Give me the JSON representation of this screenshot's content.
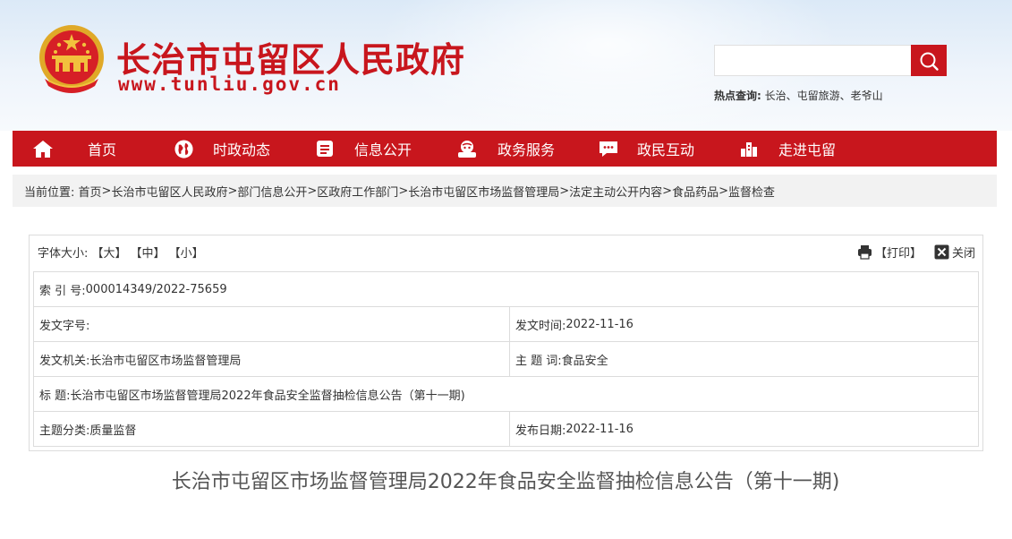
{
  "header": {
    "site_title": "长治市屯留区人民政府",
    "site_url": "www.tunliu.gov.cn",
    "hot_label": "热点查询:",
    "hot_items": "长治、屯留旅游、老爷山",
    "search_placeholder": ""
  },
  "nav": {
    "items": [
      {
        "label": "首页",
        "icon": "home-icon"
      },
      {
        "label": "时政动态",
        "icon": "globe-icon"
      },
      {
        "label": "信息公开",
        "icon": "document-icon"
      },
      {
        "label": "政务服务",
        "icon": "service-icon"
      },
      {
        "label": "政民互动",
        "icon": "chat-icon"
      },
      {
        "label": "走进屯留",
        "icon": "city-icon"
      }
    ]
  },
  "breadcrumb": {
    "label": "当前位置:",
    "items": [
      "首页",
      "长治市屯留区人民政府",
      "部门信息公开",
      "区政府工作部门",
      "长治市屯留区市场监督管理局",
      "法定主动公开内容",
      "食品药品",
      "监督检查"
    ],
    "sep_first": " > ",
    "sep": ">"
  },
  "info": {
    "font_size_label": "字体大小:",
    "font_large": "【大】",
    "font_medium": "【中】",
    "font_small": "【小】",
    "print_label": "【打印】",
    "close_label": "关闭",
    "index_label": "索 引 号:",
    "index_value": "000014349/2022-75659",
    "doc_no_label": "发文字号:",
    "doc_no_value": "",
    "issue_time_label": "发文时间:",
    "issue_time_value": "2022-11-16",
    "issuer_label": "发文机关:",
    "issuer_value": "长治市屯留区市场监督管理局",
    "subject_label": "主 题 词:",
    "subject_value": "食品安全",
    "title_label": "标 题:",
    "title_value": "长治市屯留区市场监督管理局2022年食品安全监督抽检信息公告（第十一期)",
    "category_label": "主题分类:",
    "category_value": "质量监督",
    "publish_date_label": "发布日期:",
    "publish_date_value": "2022-11-16"
  },
  "document": {
    "title": "长治市屯留区市场监督管理局2022年食品安全监督抽检信息公告（第十一期)"
  },
  "colors": {
    "brand_red": "#c8161d",
    "breadcrumb_bg": "#f2f2f2",
    "header_bg": "#dbe9f7"
  }
}
